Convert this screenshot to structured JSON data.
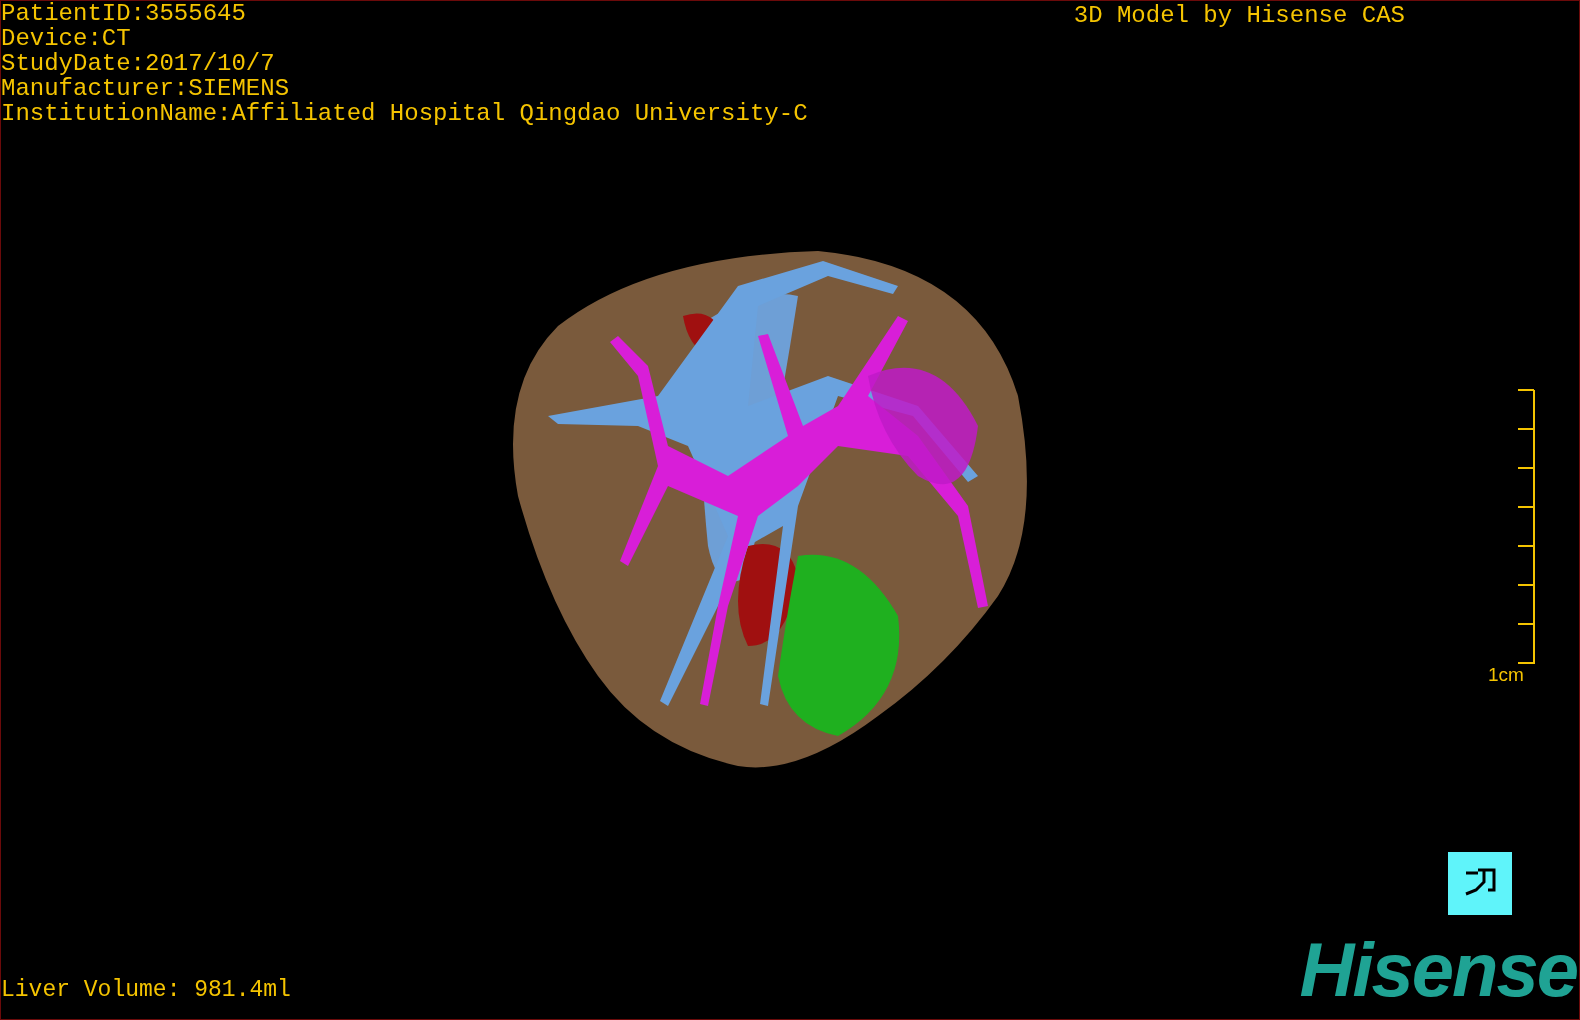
{
  "study_info": [
    "PatientID:3555645",
    "Device:CT",
    "StudyDate:2017/10/7",
    "Manufacturer:SIEMENS",
    "InstitutionName:Affiliated Hospital Qingdao University-C"
  ],
  "model_title": "3D Model by Hisense CAS",
  "scale_bar": {
    "label": "1cm"
  },
  "liver_volume": "Liver Volume: 981.4ml",
  "logo": "Hisense"
}
